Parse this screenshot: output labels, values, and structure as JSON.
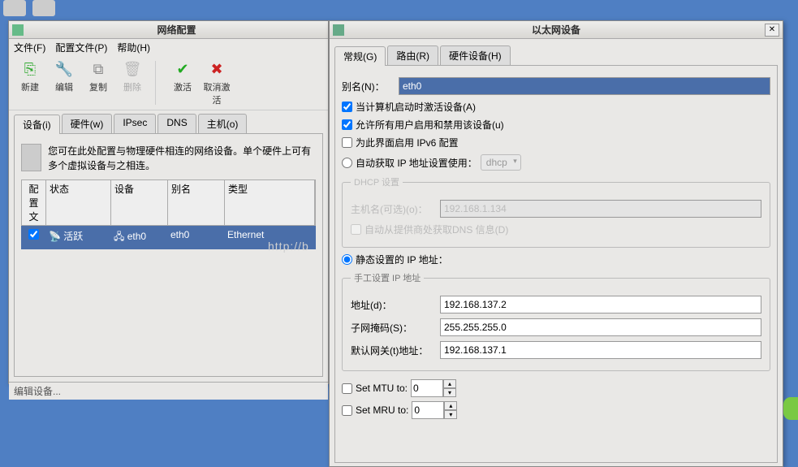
{
  "desktop": {
    "icons": [
      "computer",
      "printer"
    ]
  },
  "leftWin": {
    "title": "网络配置",
    "menubar": {
      "file": "文件(F)",
      "profile": "配置文件(P)",
      "help": "帮助(H)"
    },
    "toolbar": {
      "new": "新建",
      "edit": "编辑",
      "copy": "复制",
      "delete": "删除",
      "activate": "激活",
      "deactivate": "取消激活"
    },
    "tabs": {
      "devices": "设备(i)",
      "hardware": "硬件(w)",
      "ipsec": "IPsec",
      "dns": "DNS",
      "hosts": "主机(o)"
    },
    "info": "您可在此处配置与物理硬件相连的网络设备。单个硬件上可有多个虚拟设备与之相连。",
    "columns": {
      "profile": "配置文",
      "status": "状态",
      "device": "设备",
      "alias": "别名",
      "type": "类型"
    },
    "row": {
      "checked": true,
      "status": "活跃",
      "device": "eth0",
      "alias": "eth0",
      "type": "Ethernet"
    },
    "status": "编辑设备..."
  },
  "rightWin": {
    "title": "以太网设备",
    "tabs": {
      "general": "常规(G)",
      "route": "路由(R)",
      "hardware": "硬件设备(H)"
    },
    "alias": {
      "label": "别名(N)：",
      "value": "eth0"
    },
    "chk_activate": "当计算机启动时激活设备(A)",
    "chk_allowall": "允许所有用户启用和禁用该设备(u)",
    "chk_ipv6": "为此界面启用 IPv6 配置",
    "rad_dhcp": "自动获取 IP 地址设置使用：",
    "dhcp_combo": "dhcp",
    "dhcp_legend": "DHCP 设置",
    "dhcp_hostname_label": "主机名(可选)(o)：",
    "dhcp_hostname_value": "192.168.1.134",
    "dhcp_autodns": "自动从提供商处获取DNS 信息(D)",
    "rad_static": "静态设置的 IP 地址：",
    "static_legend": "手工设置 IP 地址",
    "addr_label": "地址(d)：",
    "addr_value": "192.168.137.2",
    "mask_label": "子网掩码(S)：",
    "mask_value": "255.255.255.0",
    "gw_label": "默认网关(t)地址：",
    "gw_value": "192.168.137.1",
    "mtu_label": "Set MTU to:",
    "mtu_value": "0",
    "mru_label": "Set MRU to:",
    "mru_value": "0"
  },
  "watermark": "http://b"
}
